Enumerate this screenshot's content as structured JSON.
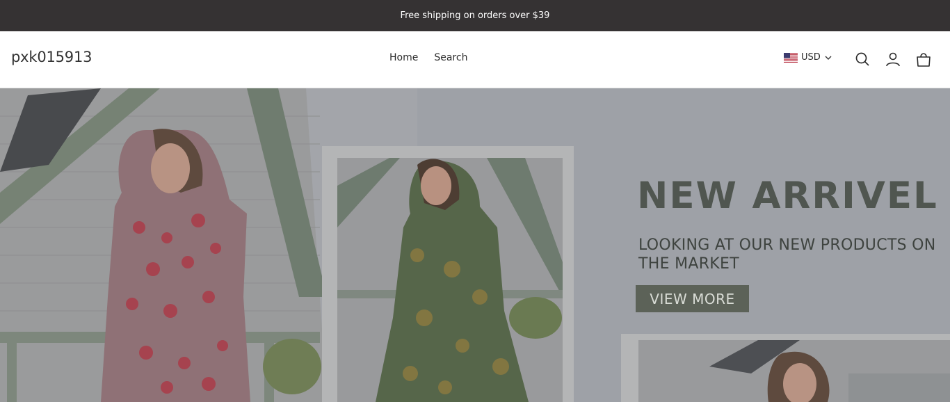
{
  "announcement": {
    "text": "Free shipping on orders over $39"
  },
  "header": {
    "logo": "pxk015913",
    "nav": [
      {
        "label": "Home"
      },
      {
        "label": "Search"
      }
    ],
    "currency": {
      "code": "USD",
      "flag": "us-flag-icon"
    },
    "icons": [
      "search-icon",
      "account-icon",
      "cart-icon"
    ]
  },
  "hero": {
    "title": "NEW ARRIVEL",
    "subtitle": "LOOKING AT OUR NEW PRODUCTS ON THE MARKET",
    "button": "VIEW MORE"
  },
  "colors": {
    "announcement_bg": "#353233",
    "hero_button_bg": "#5c6258",
    "hero_title": "#505650"
  }
}
